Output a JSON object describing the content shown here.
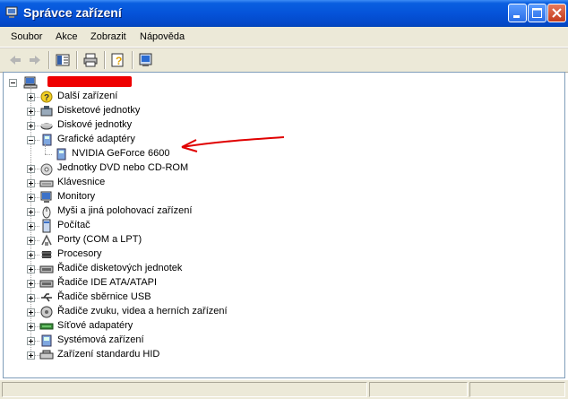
{
  "window": {
    "title": "Správce zařízení"
  },
  "menu": [
    "Soubor",
    "Akce",
    "Zobrazit",
    "Nápověda"
  ],
  "tree": {
    "root_label": "",
    "categories": [
      {
        "label": "Další zařízení",
        "icon": "question-icon"
      },
      {
        "label": "Disketové jednotky",
        "icon": "floppy-drive-icon"
      },
      {
        "label": "Diskové jednotky",
        "icon": "disk-drive-icon"
      },
      {
        "label": "Grafické adaptéry",
        "icon": "display-adapter-icon",
        "expanded": true,
        "children": [
          {
            "label": "NVIDIA GeForce 6600",
            "icon": "display-adapter-icon"
          }
        ]
      },
      {
        "label": "Jednotky DVD nebo CD-ROM",
        "icon": "cdrom-icon"
      },
      {
        "label": "Klávesnice",
        "icon": "keyboard-icon"
      },
      {
        "label": "Monitory",
        "icon": "monitor-icon"
      },
      {
        "label": "Myši a jiná polohovací zařízení",
        "icon": "mouse-icon"
      },
      {
        "label": "Počítač",
        "icon": "computer-icon"
      },
      {
        "label": "Porty (COM a LPT)",
        "icon": "port-icon"
      },
      {
        "label": "Procesory",
        "icon": "processor-icon"
      },
      {
        "label": "Řadiče disketových jednotek",
        "icon": "controller-icon"
      },
      {
        "label": "Řadiče IDE ATA/ATAPI",
        "icon": "controller-icon"
      },
      {
        "label": "Řadiče sběrnice USB",
        "icon": "usb-icon"
      },
      {
        "label": "Řadiče zvuku, videa a herních zařízení",
        "icon": "sound-icon"
      },
      {
        "label": "Síťové adapatéry",
        "icon": "network-icon"
      },
      {
        "label": "Systémová zařízení",
        "icon": "system-icon"
      },
      {
        "label": "Zařízení standardu HID",
        "icon": "hid-icon"
      }
    ]
  },
  "colors": {
    "titlebar": "#0553d9",
    "annotation_arrow": "#e00000",
    "redacted_bar": "#ee0000"
  }
}
